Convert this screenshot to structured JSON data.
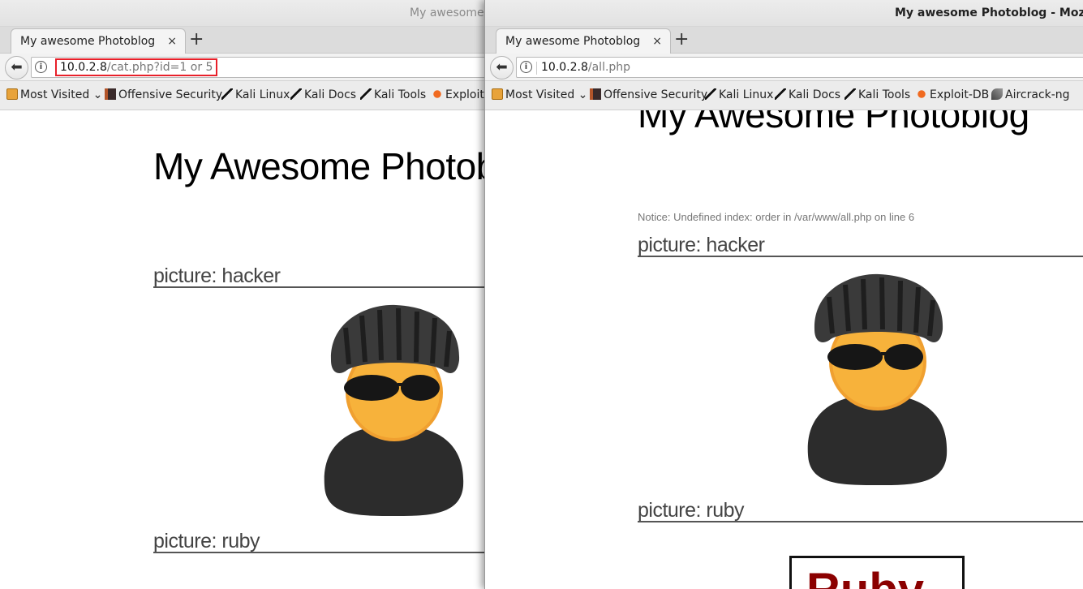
{
  "left_window": {
    "title": "My awesome",
    "tab_label": "My awesome Photoblog",
    "tab_close": "×",
    "new_tab": "+",
    "url_host": "10.0.2.8",
    "url_path": "/cat.php?id=1 or 5",
    "bookmarks": [
      "Most Visited",
      "Offensive Security",
      "Kali Linux",
      "Kali Docs",
      "Kali Tools",
      "Exploit-"
    ],
    "site_title": "My Awesome Photob",
    "pictures": [
      "picture: hacker",
      "picture: ruby"
    ]
  },
  "right_window": {
    "title": "My awesome Photoblog - Mozilla Fi",
    "tab_label": "My awesome Photoblog",
    "tab_close": "×",
    "new_tab": "+",
    "url_host": "10.0.2.8",
    "url_path": "/all.php",
    "bookmarks": [
      "Most Visited",
      "Offensive Security",
      "Kali Linux",
      "Kali Docs",
      "Kali Tools",
      "Exploit-DB",
      "Aircrack-ng"
    ],
    "site_title": "My Awesome Photoblog",
    "notice": "Notice: Undefined index: order in /var/www/all.php on line 6",
    "pictures": [
      "picture: hacker",
      "picture: ruby"
    ],
    "ruby_text": "Ruby"
  },
  "icons": {
    "back": "back-arrow-icon",
    "info": "info-icon",
    "dropdown": "chevron-down-icon"
  }
}
